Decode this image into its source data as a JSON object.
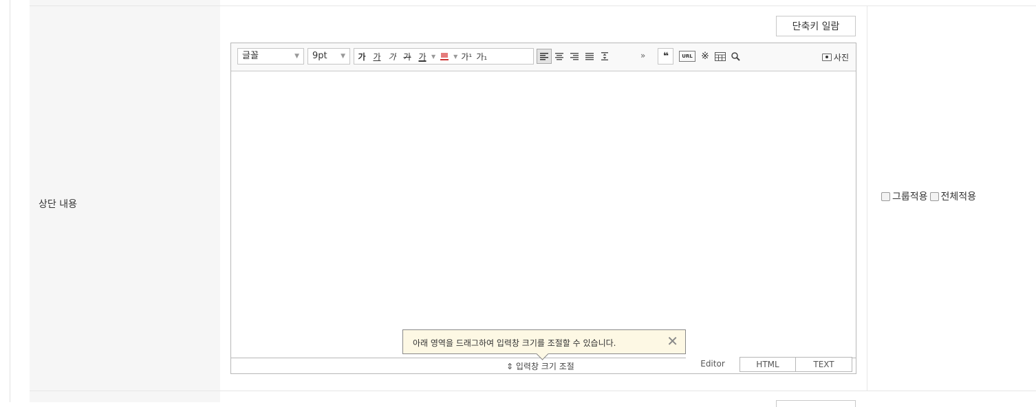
{
  "row_label": "상단 내용",
  "shortcut_button": "단축키 일람",
  "toolbar": {
    "font_select": "글꼴",
    "size_select": "9pt",
    "bold": "가",
    "underline": "가",
    "italic": "가",
    "strike": "가",
    "font_color": "가",
    "superscript": "가¹",
    "subscript": "가₁",
    "more": "»",
    "quote": "❝",
    "url": "URL",
    "special_char": "※",
    "photo": "사진"
  },
  "resize_label": "⇕ 입력창 크기 조절",
  "tooltip": {
    "text": "아래 영역을 드래그하여 입력창 크기를 조절할 수 있습니다.",
    "close": "✕"
  },
  "tabs": [
    "Editor",
    "HTML",
    "TEXT"
  ],
  "options": {
    "group_apply": "그룹적용",
    "all_apply": "전체적용"
  }
}
